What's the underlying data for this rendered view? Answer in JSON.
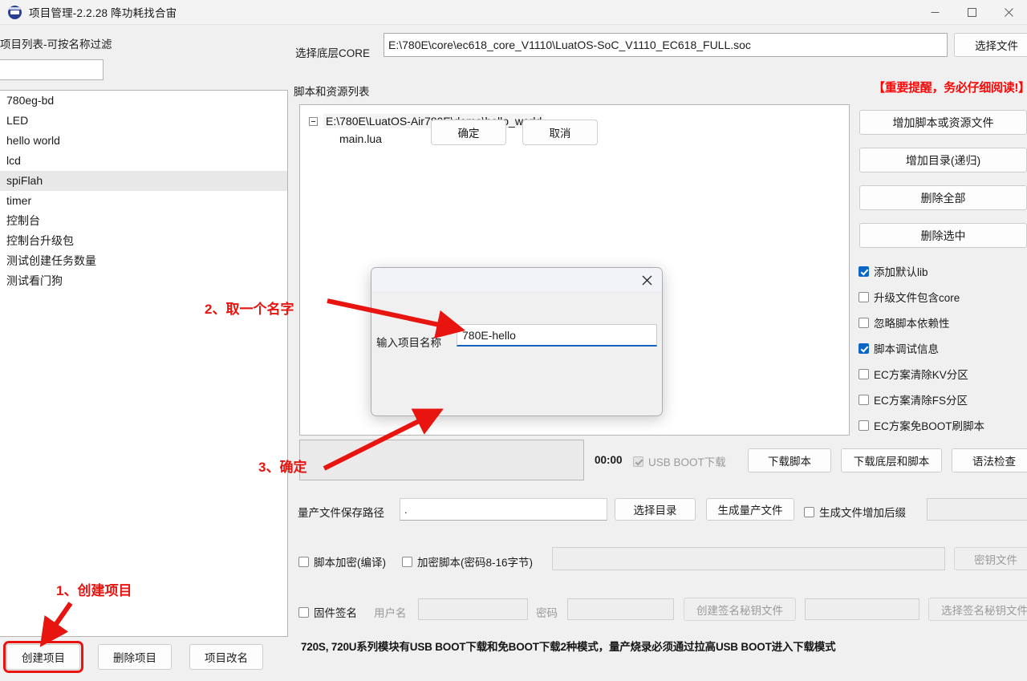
{
  "window": {
    "title": "项目管理-2.2.28 降功耗找合宙",
    "minimize_label": "最小化",
    "maximize_label": "最大化",
    "close_label": "关闭"
  },
  "left_panel": {
    "list_label": "项目列表-可按名称过滤",
    "filter_value": "",
    "filter_placeholder": "",
    "projects": [
      {
        "name": "780eg-bd",
        "selected": false
      },
      {
        "name": "LED",
        "selected": false
      },
      {
        "name": "hello world",
        "selected": false
      },
      {
        "name": "lcd",
        "selected": false
      },
      {
        "name": "spiFlah",
        "selected": true
      },
      {
        "name": "timer",
        "selected": false
      },
      {
        "name": "控制台",
        "selected": false
      },
      {
        "name": "控制台升级包",
        "selected": false
      },
      {
        "name": "测试创建任务数量",
        "selected": false
      },
      {
        "name": "测试看门狗",
        "selected": false
      }
    ],
    "buttons": [
      {
        "label": "创建项目",
        "highlighted": true
      },
      {
        "label": "删除项目",
        "highlighted": false
      },
      {
        "label": "项目改名",
        "highlighted": false
      }
    ]
  },
  "main": {
    "core_label": "选择底层CORE",
    "core_path": "E:\\780E\\core\\ec618_core_V1110\\LuatOS-SoC_V1110_EC618_FULL.soc",
    "choose_file_button": "选择文件",
    "script_list_label": "脚本和资源列表",
    "warning_text": "【重要提醒，务必仔细阅读!】",
    "tree": {
      "root": "E:\\780E\\LuatOS-Air780E\\demo\\hello_world",
      "children": [
        "main.lua"
      ]
    },
    "right_buttons": [
      "增加脚本或资源文件",
      "增加目录(递归)",
      "删除全部",
      "删除选中"
    ],
    "right_checkboxes": [
      {
        "label": "添加默认lib",
        "checked": true,
        "disabled": false
      },
      {
        "label": "升级文件包含core",
        "checked": false,
        "disabled": false
      },
      {
        "label": "忽略脚本依赖性",
        "checked": false,
        "disabled": false
      },
      {
        "label": "脚本调试信息",
        "checked": true,
        "disabled": false
      },
      {
        "label": "EC方案清除KV分区",
        "checked": false,
        "disabled": false
      },
      {
        "label": "EC方案清除FS分区",
        "checked": false,
        "disabled": false
      },
      {
        "label": "EC方案免BOOT刷脚本",
        "checked": false,
        "disabled": false
      }
    ],
    "download_row": {
      "timer": "00:00",
      "usb_boot_label": "USB BOOT下载",
      "usb_boot_checked": true,
      "usb_boot_disabled": true,
      "download_script_button": "下载脚本",
      "download_core_script_button": "下载底层和脚本",
      "syntax_check_button": "语法检查"
    },
    "mass_production": {
      "path_label": "量产文件保存路径",
      "path_value": ".",
      "choose_dir_button": "选择目录",
      "generate_button": "生成量产文件",
      "suffix_checkbox_label": "生成文件增加后缀",
      "suffix_checked": false,
      "suffix_value": ""
    },
    "encryption": {
      "compile_label": "脚本加密(编译)",
      "compile_checked": false,
      "encrypt_label": "加密脚本(密码8-16字节)",
      "encrypt_checked": false,
      "password_value": "",
      "key_file_button": "密钥文件"
    },
    "signature": {
      "sign_label": "固件签名",
      "sign_checked": false,
      "username_label": "用户名",
      "username_value": "",
      "password_label": "密码",
      "password_value": "",
      "create_key_button": "创建签名秘钥文件",
      "key_path_value": "",
      "select_key_button": "选择签名秘钥文件"
    },
    "bottom_note": "720S, 720U系列模块有USB BOOT下载和免BOOT下载2种模式，量产烧录必须通过拉高USB BOOT进入下载模式"
  },
  "dialog": {
    "close_label": "关闭",
    "field_label": "输入项目名称",
    "field_value": "780E-hello",
    "field_placeholder": "",
    "ok_button": "确定",
    "cancel_button": "取消"
  },
  "annotations": [
    {
      "id": "step1",
      "text": "1、创建项目"
    },
    {
      "id": "step2",
      "text": "2、取一个名字"
    },
    {
      "id": "step3",
      "text": "3、确定"
    }
  ],
  "colors": {
    "annotation_red": "#e8140f",
    "warning_red": "#fb0707",
    "accent_blue": "#0a66c8",
    "input_underline": "#1565c0",
    "window_bg": "#f0f0f0"
  }
}
